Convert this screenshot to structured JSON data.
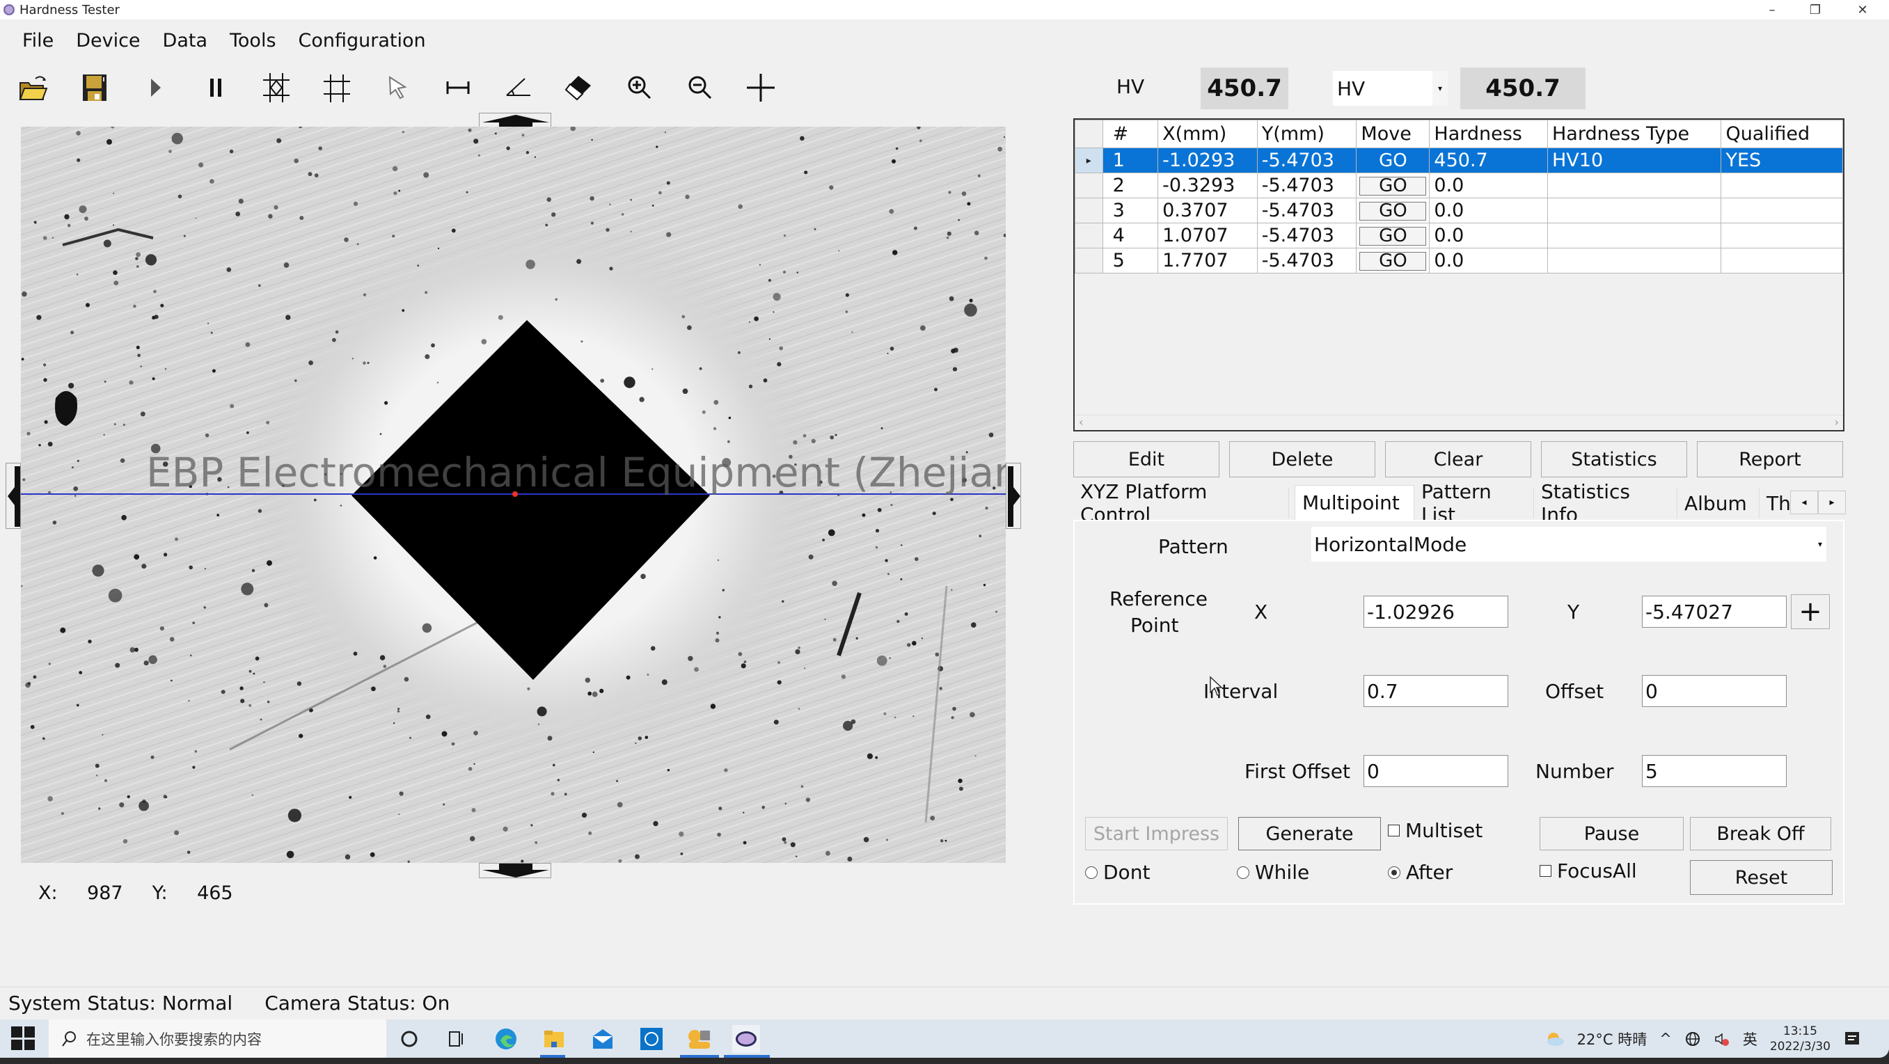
{
  "window": {
    "title": "Hardness Tester",
    "controls": {
      "minimize": "–",
      "restore": "❐",
      "close": "✕"
    }
  },
  "menu": [
    "File",
    "Device",
    "Data",
    "Tools",
    "Configuration"
  ],
  "toolbar": [
    {
      "name": "open-folder-icon",
      "label": "Open"
    },
    {
      "name": "save-icon",
      "label": "Save"
    },
    {
      "name": "play-icon",
      "label": "Play"
    },
    {
      "name": "pause-icon",
      "label": "Pause"
    },
    {
      "name": "auto-measure-icon",
      "label": "Auto Measure"
    },
    {
      "name": "grid-icon",
      "label": "Grid"
    },
    {
      "name": "select-cursor-icon",
      "label": "Select"
    },
    {
      "name": "distance-measure-icon",
      "label": "Measure Length"
    },
    {
      "name": "angle-measure-icon",
      "label": "Measure Angle"
    },
    {
      "name": "eraser-icon",
      "label": "Erase"
    },
    {
      "name": "zoom-in-icon",
      "label": "Zoom In"
    },
    {
      "name": "zoom-out-icon",
      "label": "Zoom Out"
    },
    {
      "name": "crosshair-icon",
      "label": "Crosshair"
    }
  ],
  "viewer": {
    "watermark": "EBP Electromechanical Equipment (Zhejiang) Co., Ltd.",
    "cursor_readout": {
      "x_label": "X:",
      "x_value": "987",
      "y_label": "Y:",
      "y_value": "465"
    }
  },
  "hardness_readout": {
    "label": "HV",
    "value": "450.7",
    "scale_selected": "HV",
    "converted_value": "450.7"
  },
  "table": {
    "columns": [
      "#",
      "X(mm)",
      "Y(mm)",
      "Move",
      "Hardness",
      "Hardness Type",
      "Qualified"
    ],
    "rows": [
      {
        "num": "1",
        "x": "-1.0293",
        "y": "-5.4703",
        "move": "GO",
        "hardness": "450.7",
        "type": "HV10",
        "qualified": "YES",
        "selected": true
      },
      {
        "num": "2",
        "x": "-0.3293",
        "y": "-5.4703",
        "move": "GO",
        "hardness": "0.0",
        "type": "",
        "qualified": ""
      },
      {
        "num": "3",
        "x": "0.3707",
        "y": "-5.4703",
        "move": "GO",
        "hardness": "0.0",
        "type": "",
        "qualified": ""
      },
      {
        "num": "4",
        "x": "1.0707",
        "y": "-5.4703",
        "move": "GO",
        "hardness": "0.0",
        "type": "",
        "qualified": ""
      },
      {
        "num": "5",
        "x": "1.7707",
        "y": "-5.4703",
        "move": "GO",
        "hardness": "0.0",
        "type": "",
        "qualified": ""
      }
    ]
  },
  "actions": {
    "edit": "Edit",
    "delete": "Delete",
    "clear": "Clear",
    "statistics": "Statistics",
    "report": "Report"
  },
  "tabs": [
    "XYZ Platform Control",
    "Multipoint",
    "Pattern List",
    "Statistics Info",
    "Album",
    "Th"
  ],
  "tabs_active": "Multipoint",
  "multipoint": {
    "pattern_label": "Pattern",
    "pattern_value": "HorizontalMode",
    "reference_point_label_1": "Reference",
    "reference_point_label_2": "Point",
    "x_label": "X",
    "x_value": "-1.02926",
    "y_label": "Y",
    "y_value": "-5.47027",
    "interval_label": "Interval",
    "interval_value": "0.7",
    "offset_label": "Offset",
    "offset_value": "0",
    "first_offset_label": "First Offset",
    "first_offset_value": "0",
    "number_label": "Number",
    "number_value": "5",
    "start_impress": "Start Impress",
    "generate": "Generate",
    "multiset_label": "Multiset",
    "multiset_checked": false,
    "pause": "Pause",
    "break_off": "Break Off",
    "reset": "Reset",
    "focus_all_label": "FocusAll",
    "focus_all_checked": false,
    "focus_options": [
      "Dont",
      "While",
      "After"
    ],
    "focus_selected": "After"
  },
  "status": {
    "system": "System Status: Normal",
    "camera": "Camera Status: On"
  },
  "taskbar": {
    "search_placeholder": "在这里输入你要搜索的内容",
    "weather": "22°C 時晴",
    "input_method": "英",
    "time": "13:15",
    "date": "2022/3/30"
  }
}
